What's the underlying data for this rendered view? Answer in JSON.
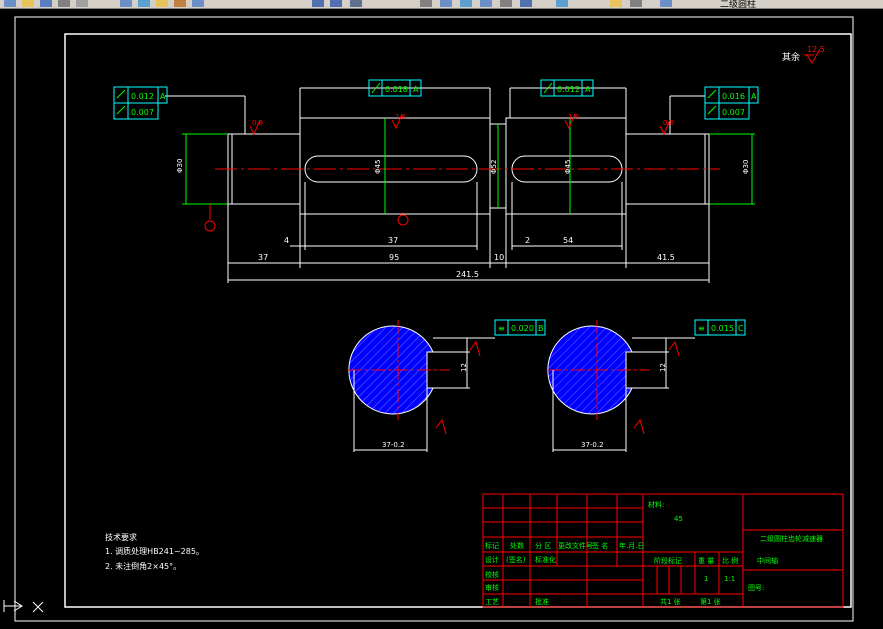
{
  "toolbar": {
    "items": [
      "new",
      "open",
      "save",
      "print",
      "preview",
      "cut",
      "copy",
      "paste",
      "undo",
      "redo",
      "pan",
      "zoom",
      "properties",
      "designcenter",
      "toolpalette",
      "sheetset",
      "markup",
      "calc",
      "help"
    ],
    "layer_label": "二级圆柱"
  },
  "drawing": {
    "roughness_note": "其余",
    "roughness_value": "12.5",
    "shaft": {
      "dims": [
        "4",
        "37",
        "2",
        "54",
        "37",
        "95",
        "10",
        "41.5",
        "241.5"
      ],
      "tol_left": {
        "values": [
          "0.012",
          "0.007"
        ],
        "datum": "A"
      },
      "tol_seg2": {
        "value": "0.018",
        "datum": "A"
      },
      "tol_seg3": {
        "value": "0.012",
        "datum": "A"
      },
      "tol_right": {
        "values": [
          "0.016",
          "0.007"
        ],
        "datum": "A"
      },
      "rough_marks": [
        "0.8",
        "1.6",
        "1.6",
        "0.8"
      ],
      "diam_labels": [
        "Φ30",
        "Φ45",
        "Φ52",
        "Φ45",
        "Φ30"
      ],
      "datum_marks": [
        "A",
        "B",
        "C"
      ]
    },
    "section1": {
      "tol": "0.020",
      "datum": "B",
      "width_dim": "12",
      "depth_dim": "37-0.2"
    },
    "section2": {
      "tol": "0.015",
      "datum": "C",
      "width_dim": "12",
      "depth_dim": "37-0.2"
    },
    "tech_req": {
      "title": "技术要求",
      "lines": [
        "1. 调质处理HB241~285。",
        "2. 未注倒角2×45°。"
      ]
    },
    "title_block": {
      "material_label": "材料:",
      "material_value": "45",
      "project": "二级圆柱齿轮减速器",
      "part_name": "中间轴",
      "drawing_no_label": "图号:",
      "row_labels": [
        "标记",
        "设计",
        "校核",
        "审核",
        "工艺"
      ],
      "header_cells": [
        "处数",
        "分 区",
        "更改文件号",
        "签 名",
        "年.月.日"
      ],
      "sign_cells": [
        "(签名)",
        "标准化"
      ],
      "stage_label": "阶段标记",
      "weight_label": "重 量",
      "scale_label": "比 例",
      "scale_value": "1:1",
      "count_value": "1",
      "approve_label": "批准",
      "sheet_total": "共1 张",
      "sheet_no": "第1 张"
    }
  },
  "colors": {
    "green": "#00ff00",
    "red": "#ff0000",
    "white": "#ffffff",
    "cyan": "#00ffff",
    "blue": "#0000ff"
  }
}
